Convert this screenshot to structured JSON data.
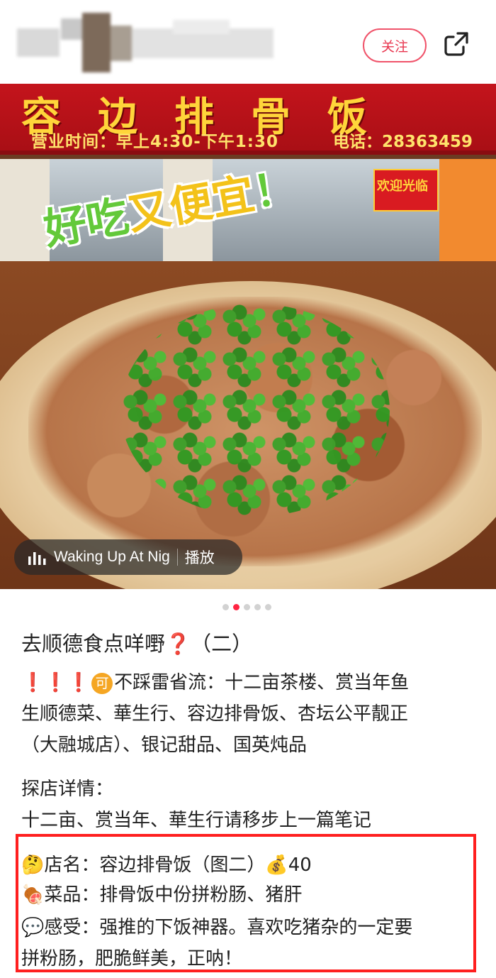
{
  "header": {
    "follow_label": "关注",
    "share_icon": "share-icon"
  },
  "photo": {
    "sign": {
      "title": "容边排骨饭",
      "hours": "营业时间：早上4:30-下午1:30",
      "phone": "电话：28363459"
    },
    "banner_text": "欢迎光临",
    "slogan": {
      "part1": "好吃",
      "part2": "又便宜",
      "part3": "！"
    },
    "music": {
      "track": "Waking Up At Nig",
      "play_label": "播放",
      "icon": "audio-bars-icon"
    }
  },
  "pagination": {
    "total": 5,
    "active_index": 1
  },
  "post": {
    "title": "去顺德食点咩嘢❓（二）",
    "recommend_prefix": "❗❗❗",
    "recommend_badge": "可",
    "recommend_text_line1": "不踩雷省流：十二亩茶楼、赏当年鱼",
    "recommend_text_line2": "生顺德菜、華生行、容边排骨饭、杏坛公平靓正",
    "recommend_text_line3": "（大融城店）、银记甜品、国英炖品",
    "details_heading": "探店详情：",
    "details_line": "十二亩、赏当年、華生行请移步上一篇笔记"
  },
  "highlight": {
    "shop_emoji": "🤔",
    "shop_line": "店名：容边排骨饭（图二）",
    "price_emoji": "💰",
    "price": "40",
    "dish_emoji": "🍖",
    "dish_line": "菜品：排骨饭中份拼粉肠、猪肝",
    "feel_emoji": "💬",
    "feel_line1": "感受：强推的下饭神器。喜欢吃猪杂的一定要",
    "feel_line2": "拼粉肠，肥脆鲜美，正呐！"
  },
  "colors": {
    "accent": "#ff2442",
    "follow_border": "#f0536a",
    "highlight_border": "#ff1f1f"
  }
}
